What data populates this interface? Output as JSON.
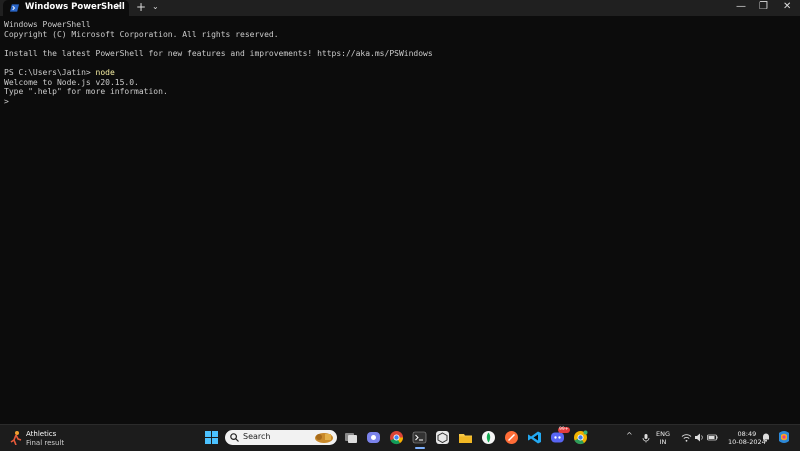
{
  "window": {
    "tab_title": "Windows PowerShell",
    "tab_close": "✕",
    "new_tab": "+",
    "dropdown": "⌄",
    "minimize": "—",
    "maximize": "❐",
    "close": "✕"
  },
  "terminal": {
    "lines": [
      "Windows PowerShell",
      "Copyright (C) Microsoft Corporation. All rights reserved.",
      "",
      "Install the latest PowerShell for new features and improvements! https://aka.ms/PSWindows",
      ""
    ],
    "prompt": "PS C:\\Users\\Jatin> ",
    "command": "node",
    "output": [
      "Welcome to Node.js v20.15.0.",
      "Type \".help\" for more information."
    ],
    "repl_prompt": ">"
  },
  "taskbar": {
    "widget_title": "Athletics",
    "widget_subtitle": "Final result",
    "search_label": "Search",
    "tray_chevron": "^",
    "lang_1": "ENG",
    "lang_2": "IN",
    "time": "08:49",
    "date": "10-08-2024",
    "discord_badge": "99+"
  },
  "colors": {
    "terminal_bg": "#0c0c0c",
    "terminal_text": "#cccccc",
    "command_highlight": "#f9f1a5",
    "taskbar_bg": "#1c1c1c"
  }
}
